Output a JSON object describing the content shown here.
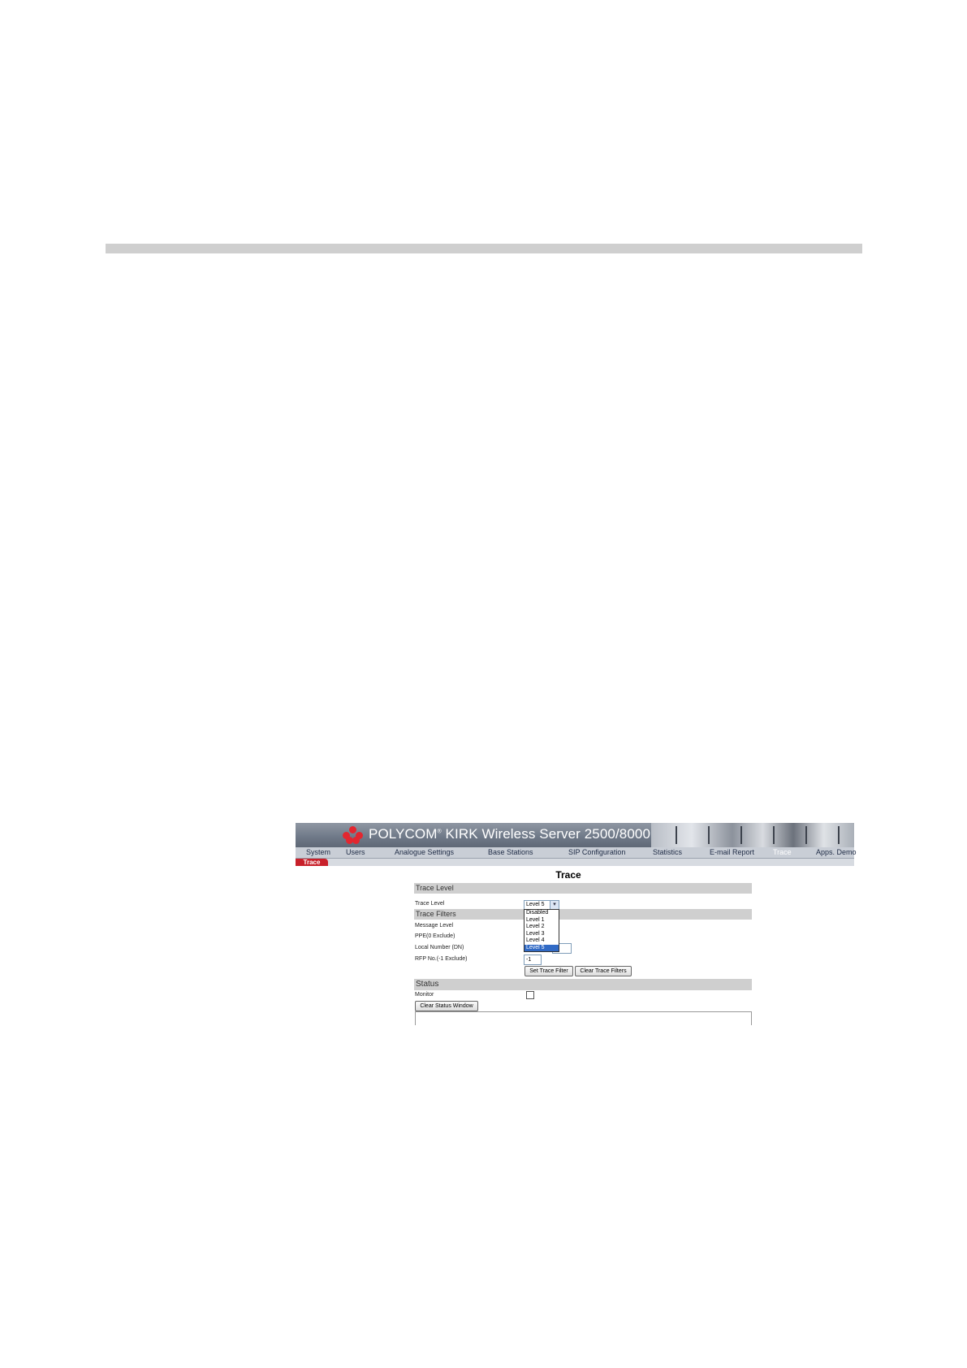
{
  "banner": {
    "brand": "POLYCOM",
    "reg_mark": "®",
    "product": " KIRK Wireless Server 2500/8000"
  },
  "nav": {
    "items": [
      "System",
      "Users",
      "Analogue Settings",
      "Base Stations",
      "SIP Configuration",
      "Statistics",
      "E-mail Report",
      "Trace",
      "Apps. Demo"
    ],
    "active": "Trace",
    "subtab": "Trace"
  },
  "page": {
    "title": "Trace",
    "sections": {
      "trace_level": "Trace Level",
      "trace_filters": "Trace Filters",
      "status": "Status"
    },
    "labels": {
      "trace_level": "Trace Level",
      "message_level": "Message Level",
      "ppe": "PPE(0 Exclude)",
      "local_number": "Local Number (DN)",
      "rfp_no": "RFP No.(-1 Exclude)",
      "monitor": "Monitor"
    },
    "trace_level_select": {
      "value": "Level 5",
      "options": [
        "Disabled",
        "Level 1",
        "Level 2",
        "Level 3",
        "Level 4",
        "Level 5"
      ],
      "highlighted": "Level 5"
    },
    "rfp_no_value": "-1",
    "buttons": {
      "set_trace_filter": "Set Trace Filter",
      "clear_trace_filters": "Clear Trace Filters",
      "clear_status_window": "Clear Status Window"
    },
    "monitor_checked": false
  },
  "colors": {
    "banner": "#6e7887",
    "logo": "#e3262f",
    "subtab": "#c8202a",
    "section_bg": "#cfcfcf",
    "dropdown_highlight": "#316ac5"
  }
}
